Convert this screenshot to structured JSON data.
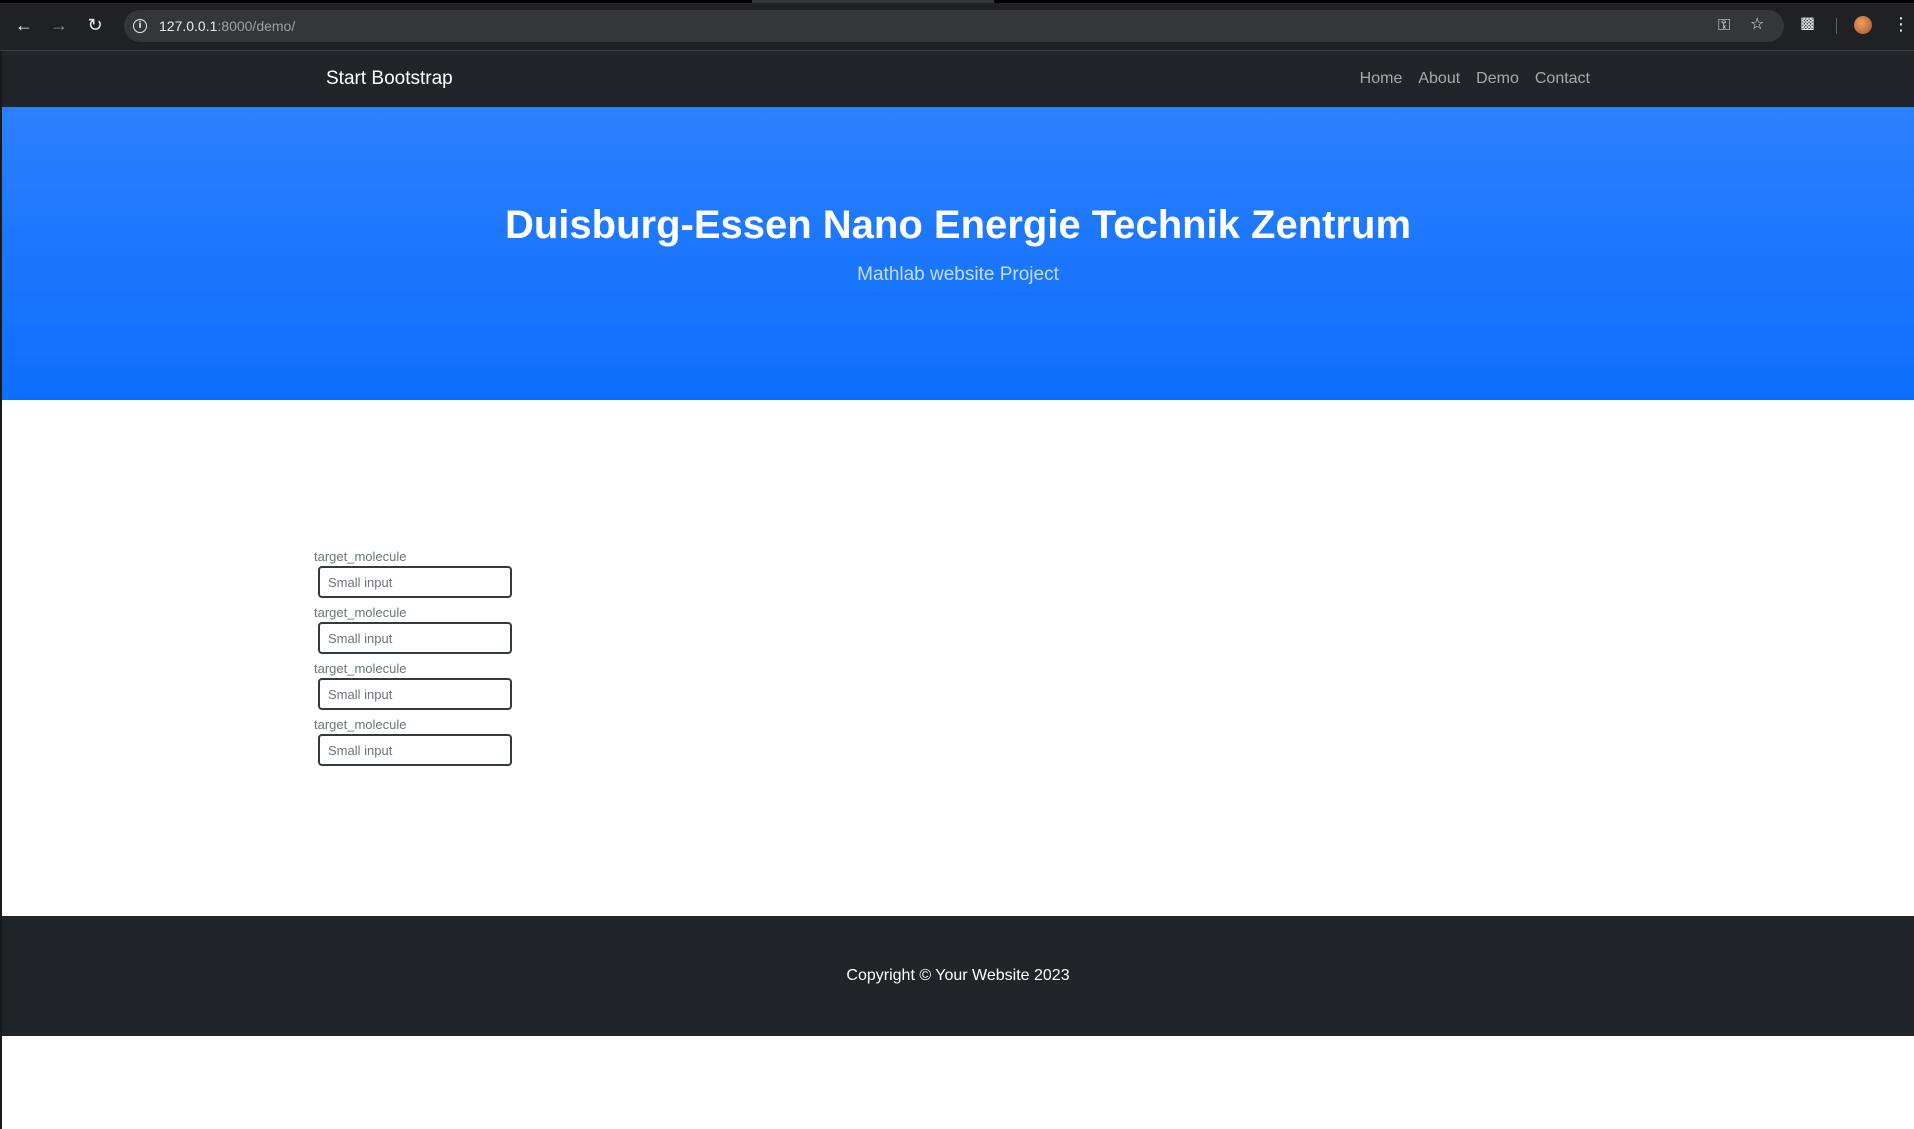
{
  "browser": {
    "url_host": "127.0.0.1",
    "url_path": ":8000/demo/",
    "back_icon": "back-arrow-icon",
    "forward_icon": "forward-arrow-icon",
    "reload_icon": "reload-icon"
  },
  "navbar": {
    "brand": "Start Bootstrap",
    "links": [
      {
        "label": "Home"
      },
      {
        "label": "About"
      },
      {
        "label": "Demo"
      },
      {
        "label": "Contact"
      }
    ]
  },
  "hero": {
    "title": "Duisburg-Essen Nano Energie Technik Zentrum",
    "subtitle": "Mathlab website Project"
  },
  "form": {
    "fields": [
      {
        "label": "target_molecule",
        "placeholder": "Small input",
        "value": ""
      },
      {
        "label": "target_molecule",
        "placeholder": "Small input",
        "value": ""
      },
      {
        "label": "target_molecule",
        "placeholder": "Small input",
        "value": ""
      },
      {
        "label": "target_molecule",
        "placeholder": "Small input",
        "value": ""
      }
    ]
  },
  "footer": {
    "copyright": "Copyright © Your Website 2023"
  },
  "colors": {
    "navbar_bg": "#212529",
    "hero_bg": "#0d6efd",
    "footer_bg": "#212529"
  }
}
